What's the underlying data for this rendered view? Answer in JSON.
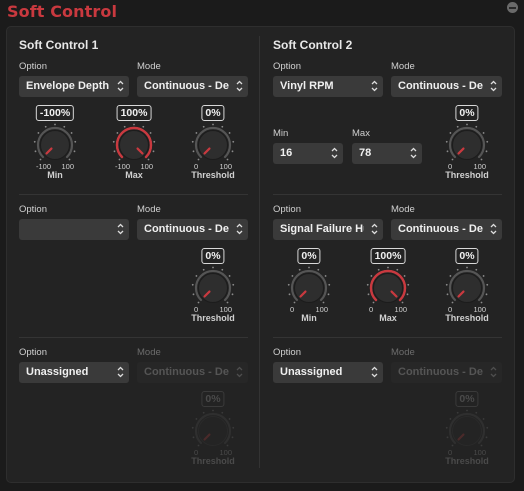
{
  "window": {
    "title": "Soft Control"
  },
  "sc1": {
    "title": "Soft Control 1",
    "row1": {
      "option_label": "Option",
      "option_value": "Envelope Depth - ...",
      "mode_label": "Mode",
      "mode_value": "Continuous - Dead Zone",
      "knobs": [
        {
          "value": "-100%",
          "lo": "-100",
          "hi": "100",
          "name": "Min",
          "level": 0
        },
        {
          "value": "100%",
          "lo": "-100",
          "hi": "100",
          "name": "Max",
          "level": 1
        },
        {
          "value": "0%",
          "lo": "0",
          "hi": "100",
          "name": "Threshold",
          "level": 0
        }
      ]
    },
    "row2": {
      "option_label": "Option",
      "option_value": "",
      "mode_label": "Mode",
      "mode_value": "Continuous - Dead Zone",
      "knobs": [
        {
          "value": "0%",
          "lo": "0",
          "hi": "100",
          "name": "Threshold",
          "level": 0
        }
      ]
    },
    "row3": {
      "option_label": "Option",
      "option_value": "Unassigned",
      "mode_label": "Mode",
      "mode_value": "Continuous - Dead Zone",
      "knobs": [
        {
          "value": "0%",
          "lo": "0",
          "hi": "100",
          "name": "Threshold",
          "level": 0
        }
      ]
    }
  },
  "sc2": {
    "title": "Soft Control 2",
    "row1": {
      "option_label": "Option",
      "option_value": "Vinyl RPM",
      "mode_label": "Mode",
      "mode_value": "Continuous - Dead Zone",
      "min_label": "Min",
      "min_value": "16",
      "max_label": "Max",
      "max_value": "78",
      "knobs": [
        {
          "value": "0%",
          "lo": "0",
          "hi": "100",
          "name": "Threshold",
          "level": 0
        }
      ]
    },
    "row2": {
      "option_label": "Option",
      "option_value": "Signal Failure Hum",
      "mode_label": "Mode",
      "mode_value": "Continuous - Dead Zone",
      "knobs": [
        {
          "value": "0%",
          "lo": "0",
          "hi": "100",
          "name": "Min",
          "level": 0
        },
        {
          "value": "100%",
          "lo": "0",
          "hi": "100",
          "name": "Max",
          "level": 1
        },
        {
          "value": "0%",
          "lo": "0",
          "hi": "100",
          "name": "Threshold",
          "level": 0
        }
      ]
    },
    "row3": {
      "option_label": "Option",
      "option_value": "Unassigned",
      "mode_label": "Mode",
      "mode_value": "Continuous - Dead Zone",
      "knobs": [
        {
          "value": "0%",
          "lo": "0",
          "hi": "100",
          "name": "Threshold",
          "level": 0
        }
      ]
    }
  },
  "colors": {
    "accent": "#c9393f",
    "knob_face": "#2e2e2e",
    "track": "#555555",
    "active_arc": "#c9393f"
  },
  "icons": {
    "dropdown": "updown-chevron-icon",
    "close": "minus-circle-icon"
  }
}
